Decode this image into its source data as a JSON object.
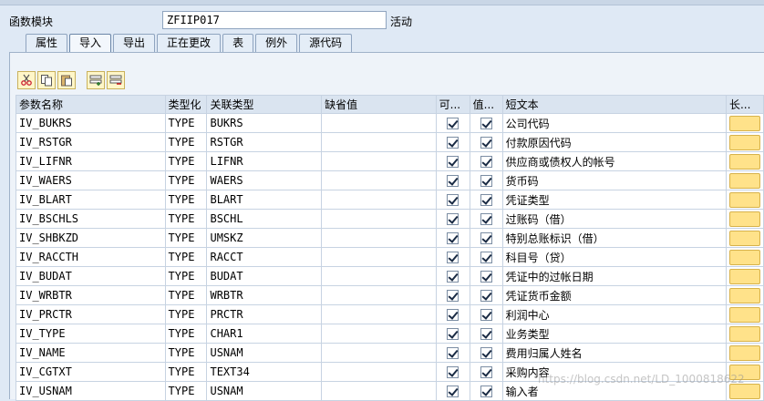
{
  "header": {
    "function_module_label": "函数模块",
    "function_module_value": "ZFIIP017",
    "status": "活动"
  },
  "tabs": [
    {
      "label": "属性",
      "active": false
    },
    {
      "label": "导入",
      "active": true
    },
    {
      "label": "导出",
      "active": false
    },
    {
      "label": "正在更改",
      "active": false
    },
    {
      "label": "表",
      "active": false
    },
    {
      "label": "例外",
      "active": false
    },
    {
      "label": "源代码",
      "active": false
    }
  ],
  "toolbar": {
    "icons": [
      "cut-icon",
      "copy-icon",
      "paste-icon",
      "insert-row-icon",
      "delete-row-icon"
    ]
  },
  "table": {
    "columns": [
      "参数名称",
      "类型化",
      "关联类型",
      "缺省值",
      "可...",
      "值...",
      "短文本",
      "长..."
    ],
    "rows": [
      {
        "name": "IV_BUKRS",
        "typing": "TYPE",
        "assoc": "BUKRS",
        "default": "",
        "optional": true,
        "pass_value": true,
        "short_text": "公司代码"
      },
      {
        "name": "IV_RSTGR",
        "typing": "TYPE",
        "assoc": "RSTGR",
        "default": "",
        "optional": true,
        "pass_value": true,
        "short_text": "付款原因代码"
      },
      {
        "name": "IV_LIFNR",
        "typing": "TYPE",
        "assoc": "LIFNR",
        "default": "",
        "optional": true,
        "pass_value": true,
        "short_text": "供应商或债权人的帐号"
      },
      {
        "name": "IV_WAERS",
        "typing": "TYPE",
        "assoc": "WAERS",
        "default": "",
        "optional": true,
        "pass_value": true,
        "short_text": "货币码"
      },
      {
        "name": "IV_BLART",
        "typing": "TYPE",
        "assoc": "BLART",
        "default": "",
        "optional": true,
        "pass_value": true,
        "short_text": "凭证类型"
      },
      {
        "name": "IV_BSCHLS",
        "typing": "TYPE",
        "assoc": "BSCHL",
        "default": "",
        "optional": true,
        "pass_value": true,
        "short_text": "过账码（借）"
      },
      {
        "name": "IV_SHBKZD",
        "typing": "TYPE",
        "assoc": "UMSKZ",
        "default": "",
        "optional": true,
        "pass_value": true,
        "short_text": "特别总账标识（借）"
      },
      {
        "name": "IV_RACCTH",
        "typing": "TYPE",
        "assoc": "RACCT",
        "default": "",
        "optional": true,
        "pass_value": true,
        "short_text": "科目号（贷）"
      },
      {
        "name": "IV_BUDAT",
        "typing": "TYPE",
        "assoc": "BUDAT",
        "default": "",
        "optional": true,
        "pass_value": true,
        "short_text": "凭证中的过帐日期"
      },
      {
        "name": "IV_WRBTR",
        "typing": "TYPE",
        "assoc": "WRBTR",
        "default": "",
        "optional": true,
        "pass_value": true,
        "short_text": "凭证货币金额"
      },
      {
        "name": "IV_PRCTR",
        "typing": "TYPE",
        "assoc": "PRCTR",
        "default": "",
        "optional": true,
        "pass_value": true,
        "short_text": "利润中心"
      },
      {
        "name": "IV_TYPE",
        "typing": "TYPE",
        "assoc": "CHAR1",
        "default": "",
        "optional": true,
        "pass_value": true,
        "short_text": "业务类型"
      },
      {
        "name": "IV_NAME",
        "typing": "TYPE",
        "assoc": "USNAM",
        "default": "",
        "optional": true,
        "pass_value": true,
        "short_text": "费用归属人姓名"
      },
      {
        "name": "IV_CGTXT",
        "typing": "TYPE",
        "assoc": "TEXT34",
        "default": "",
        "optional": true,
        "pass_value": true,
        "short_text": "采购内容"
      },
      {
        "name": "IV_USNAM",
        "typing": "TYPE",
        "assoc": "USNAM",
        "default": "",
        "optional": true,
        "pass_value": true,
        "short_text": "输入者"
      }
    ]
  },
  "watermark": "https://blog.csdn.net/LD_1000818622"
}
